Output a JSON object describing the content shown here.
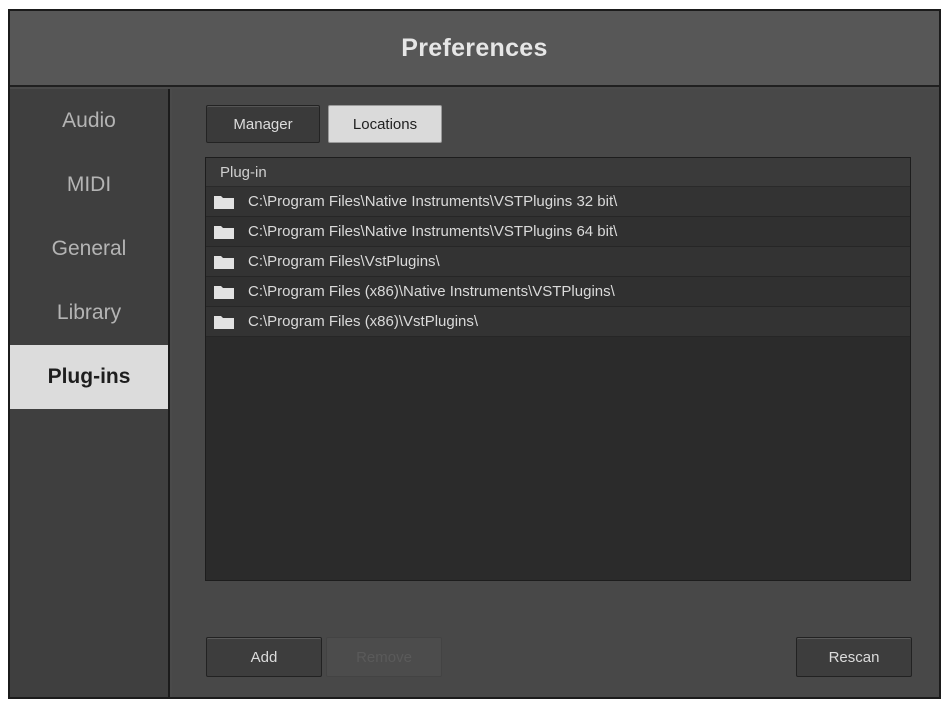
{
  "window": {
    "title": "Preferences"
  },
  "sidebar": {
    "items": [
      {
        "label": "Audio",
        "active": false
      },
      {
        "label": "MIDI",
        "active": false
      },
      {
        "label": "General",
        "active": false
      },
      {
        "label": "Library",
        "active": false
      },
      {
        "label": "Plug-ins",
        "active": true
      }
    ]
  },
  "tabs": [
    {
      "label": "Manager",
      "active": false
    },
    {
      "label": "Locations",
      "active": true
    }
  ],
  "list": {
    "header": "Plug-in",
    "icon": "folder-icon",
    "rows": [
      "C:\\Program Files\\Native Instruments\\VSTPlugins 32 bit\\",
      "C:\\Program Files\\Native Instruments\\VSTPlugins 64 bit\\",
      "C:\\Program Files\\VstPlugins\\",
      "C:\\Program Files (x86)\\Native Instruments\\VSTPlugins\\",
      "C:\\Program Files (x86)\\VstPlugins\\"
    ]
  },
  "buttons": {
    "add": "Add",
    "remove": "Remove",
    "remove_enabled": false,
    "rescan": "Rescan"
  },
  "colors": {
    "window_bg": "#4a4a4a",
    "active_tab_bg": "#dadada",
    "list_bg": "#2b2b2b"
  }
}
